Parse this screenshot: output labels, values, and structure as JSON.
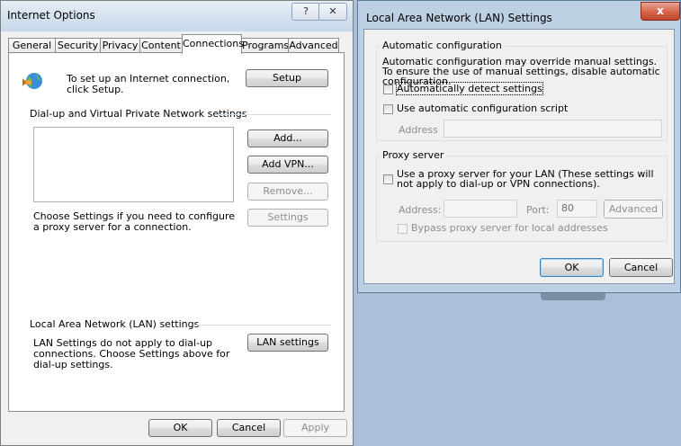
{
  "io": {
    "title": "Internet Options",
    "help_glyph": "?",
    "close_glyph": "✕",
    "tabs": [
      "General",
      "Security",
      "Privacy",
      "Content",
      "Connections",
      "Programs",
      "Advanced"
    ],
    "setup_text": "To set up an Internet connection, click Setup.",
    "setup_button": "Setup",
    "dialup_heading": "Dial-up and Virtual Private Network settings",
    "add_button": "Add...",
    "add_vpn_button": "Add VPN...",
    "remove_button": "Remove...",
    "settings_text": "Choose Settings if you need to configure a proxy server for a connection.",
    "settings_button": "Settings",
    "lan_heading": "Local Area Network (LAN) settings",
    "lan_text": "LAN Settings do not apply to dial-up connections. Choose Settings above for dial-up settings.",
    "lan_button": "LAN settings",
    "ok_button": "OK",
    "cancel_button": "Cancel",
    "apply_button": "Apply"
  },
  "lan": {
    "title": "Local Area Network (LAN) Settings",
    "close_glyph": "x",
    "auto_heading": "Automatic configuration",
    "auto_desc": "Automatic configuration may override manual settings.  To ensure the use of manual settings, disable automatic configuration.",
    "auto_detect_label": "Automatically detect settings",
    "auto_script_label": "Use automatic configuration script",
    "address_label": "Address",
    "address_value": "",
    "proxy_heading": "Proxy server",
    "proxy_label": "Use a proxy server for your LAN (These settings will not apply to dial-up or VPN connections).",
    "proxy_address_label": "Address:",
    "proxy_address_value": "",
    "port_label": "Port:",
    "port_value": "80",
    "advanced_button": "Advanced",
    "bypass_label": "Bypass proxy server for local addresses",
    "ok_button": "OK",
    "cancel_button": "Cancel",
    "auto_detect_checked": false,
    "auto_script_checked": false,
    "proxy_checked": false,
    "bypass_checked": false
  },
  "colors": {
    "desktop": "#a9c0d8",
    "close_red": "#c2452a",
    "focus_blue": "#3c7fb1"
  }
}
